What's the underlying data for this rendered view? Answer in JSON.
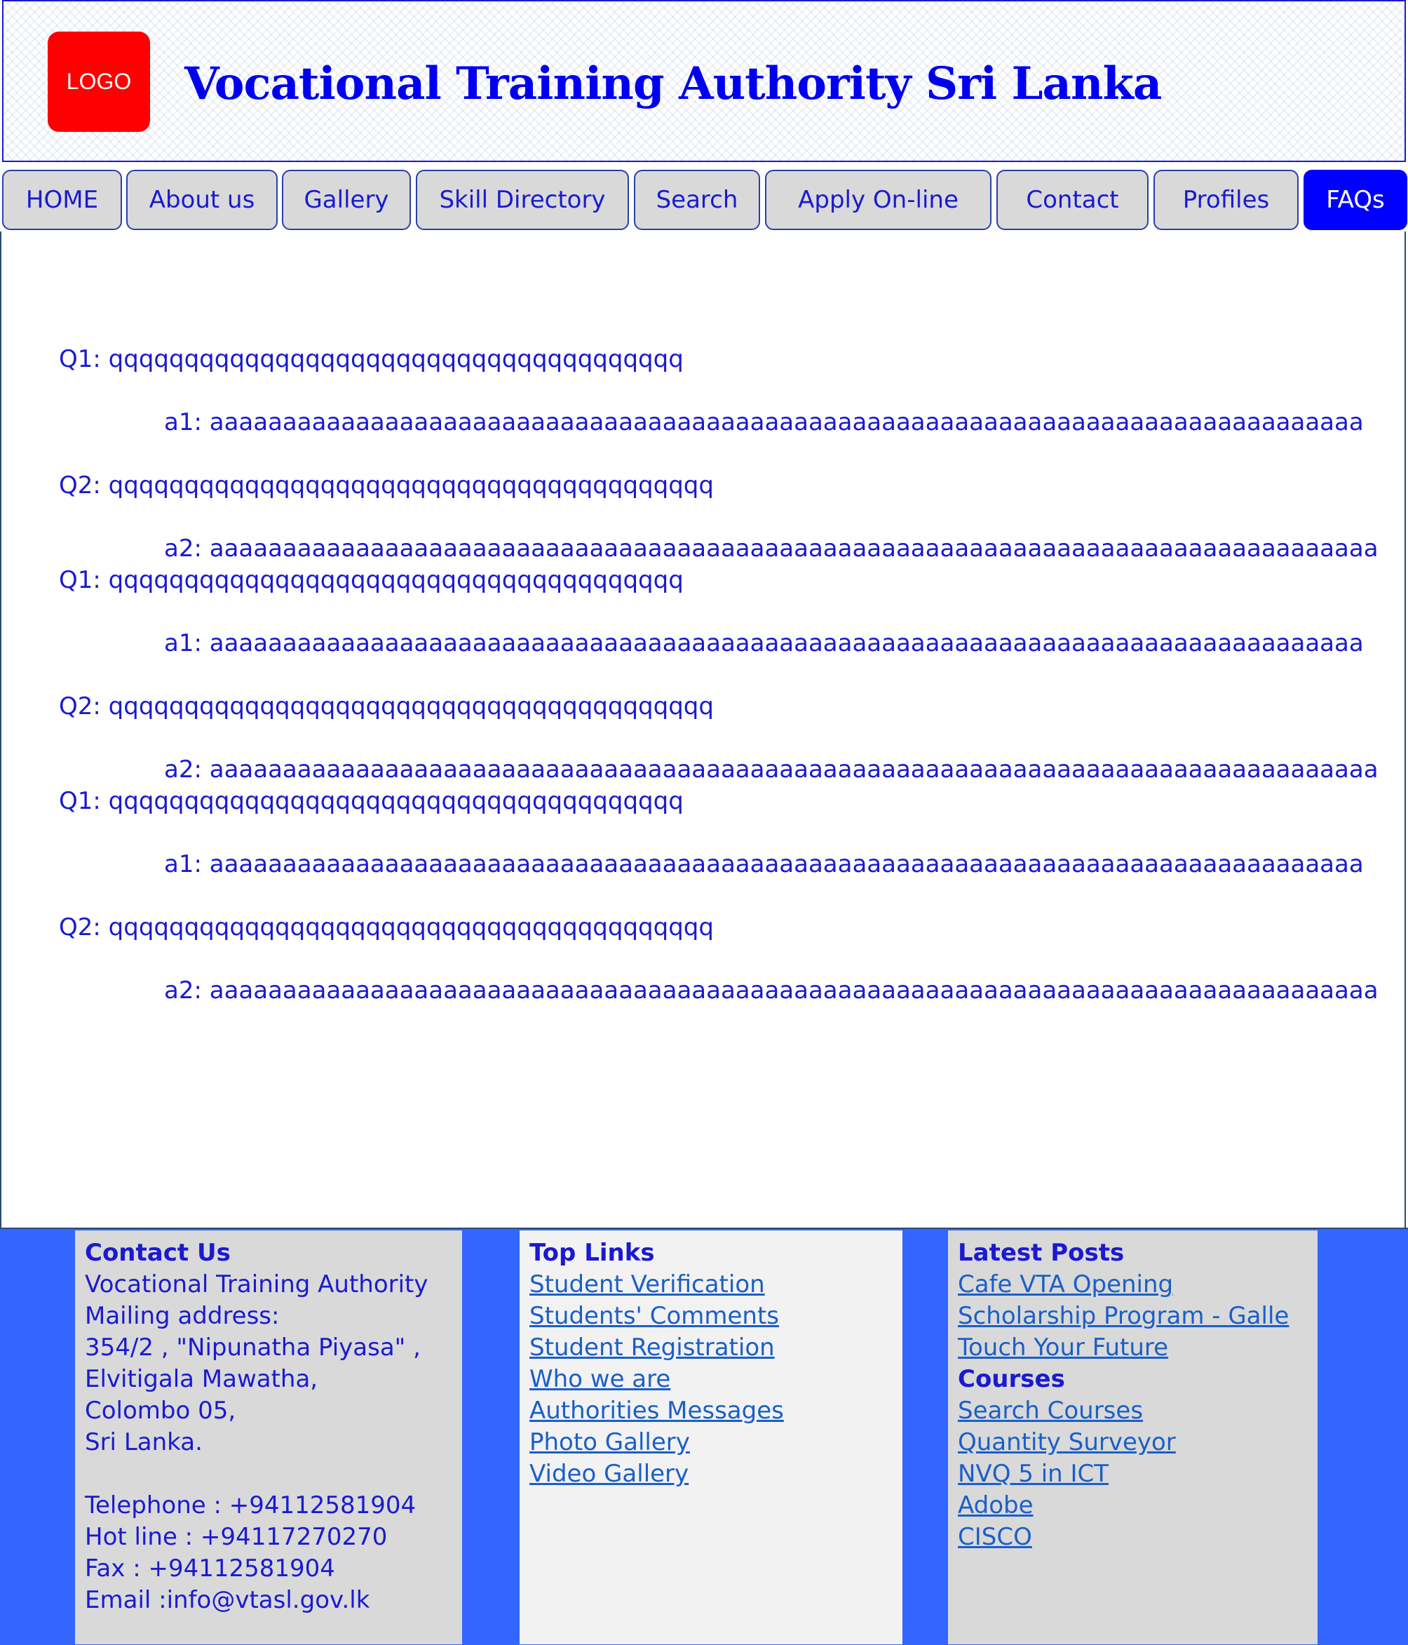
{
  "header": {
    "logo_text": "LOGO",
    "title": "Vocational Training Authority Sri Lanka"
  },
  "nav": [
    {
      "label": "HOME",
      "active": false
    },
    {
      "label": "About us",
      "active": false
    },
    {
      "label": "Gallery",
      "active": false
    },
    {
      "label": "Skill Directory",
      "active": false
    },
    {
      "label": "Search",
      "active": false
    },
    {
      "label": "Apply On-line",
      "active": false
    },
    {
      "label": "Contact",
      "active": false
    },
    {
      "label": "Profiles",
      "active": false
    },
    {
      "label": "FAQs",
      "active": true
    }
  ],
  "faqs": [
    {
      "q1": "Q1: qqqqqqqqqqqqqqqqqqqqqqqqqqqqqqqqqqqqqq",
      "a1": "a1: aaaaaaaaaaaaaaaaaaaaaaaaaaaaaaaaaaaaaaaaaaaaaaaaaaaaaaaaaaaaaaaaaaaaaaaaaaaaaaa",
      "q2": "Q2: qqqqqqqqqqqqqqqqqqqqqqqqqqqqqqqqqqqqqqqq",
      "a2": "a2: aaaaaaaaaaaaaaaaaaaaaaaaaaaaaaaaaaaaaaaaaaaaaaaaaaaaaaaaaaaaaaaaaaaaaaaaaaaaaaaa"
    },
    {
      "q1": "Q1: qqqqqqqqqqqqqqqqqqqqqqqqqqqqqqqqqqqqqq",
      "a1": "a1: aaaaaaaaaaaaaaaaaaaaaaaaaaaaaaaaaaaaaaaaaaaaaaaaaaaaaaaaaaaaaaaaaaaaaaaaaaaaaaa",
      "q2": "Q2: qqqqqqqqqqqqqqqqqqqqqqqqqqqqqqqqqqqqqqqq",
      "a2": "a2: aaaaaaaaaaaaaaaaaaaaaaaaaaaaaaaaaaaaaaaaaaaaaaaaaaaaaaaaaaaaaaaaaaaaaaaaaaaaaaaa"
    },
    {
      "q1": "Q1: qqqqqqqqqqqqqqqqqqqqqqqqqqqqqqqqqqqqqq",
      "a1": "a1: aaaaaaaaaaaaaaaaaaaaaaaaaaaaaaaaaaaaaaaaaaaaaaaaaaaaaaaaaaaaaaaaaaaaaaaaaaaaaaa",
      "q2": "Q2: qqqqqqqqqqqqqqqqqqqqqqqqqqqqqqqqqqqqqqqq",
      "a2": "a2: aaaaaaaaaaaaaaaaaaaaaaaaaaaaaaaaaaaaaaaaaaaaaaaaaaaaaaaaaaaaaaaaaaaaaaaaaaaaaaaa"
    }
  ],
  "footer": {
    "contact": {
      "heading": "Contact Us",
      "lines": [
        "Vocational Training Authority",
        "Mailing address:",
        "354/2 , \"Nipunatha Piyasa\" ,",
        "Elvitigala Mawatha,",
        "Colombo 05,",
        "Sri Lanka."
      ],
      "telephone": "Telephone : +94112581904",
      "hotline": "Hot line : +94117270270",
      "fax": "Fax : +94112581904",
      "email": "Email :info@vtasl.gov.lk"
    },
    "top_links": {
      "heading": "Top Links",
      "links": [
        "Student Verification",
        "Students' Comments",
        "Student Registration",
        "Who we are",
        "Authorities Messages",
        "Photo Gallery",
        "Video Gallery"
      ]
    },
    "latest_posts": {
      "heading": "Latest Posts",
      "links": [
        "Cafe VTA Opening",
        "Scholarship Program - Galle",
        "Touch Your Future"
      ]
    },
    "courses": {
      "heading": "Courses",
      "links": [
        "Search Courses",
        "Quantity Surveyor",
        "NVQ 5 in ICT",
        "Adobe",
        "CISCO"
      ]
    }
  }
}
